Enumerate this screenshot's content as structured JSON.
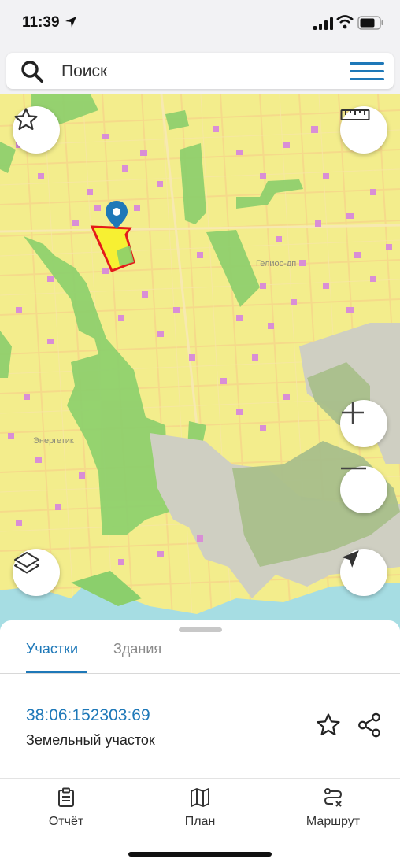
{
  "status_bar": {
    "time": "11:39",
    "icons": [
      "location-arrow-icon",
      "signal-icon",
      "wifi-icon",
      "battery-icon"
    ]
  },
  "search": {
    "placeholder": "Поиск",
    "icon": "search-icon",
    "menu_icon": "hamburger-menu-icon"
  },
  "map": {
    "labels": {
      "geliosdp": "Гелиос-дп",
      "energetik": "Энергетик"
    },
    "controls": [
      "favorites-star-icon",
      "ruler-icon",
      "zoom-in-icon",
      "zoom-out-icon",
      "layers-icon",
      "my-location-icon"
    ],
    "colors": {
      "land": "#f3ed8c",
      "green": "#8bcf6c",
      "selected_parcel": "#f7f032",
      "selected_border": "#e41a1a",
      "pin": "#1e78b8",
      "water": "#a6dde3"
    }
  },
  "sheet": {
    "tabs": [
      {
        "label": "Участки"
      },
      {
        "label": "Здания"
      }
    ],
    "parcel": {
      "id": "38:06:152303:69",
      "type": "Земельный участок"
    }
  },
  "bottom_nav": [
    {
      "label": "Отчёт",
      "icon": "report-clipboard-icon"
    },
    {
      "label": "План",
      "icon": "map-plan-icon"
    },
    {
      "label": "Маршрут",
      "icon": "route-icon"
    }
  ],
  "accent_color": "#1e78b8"
}
